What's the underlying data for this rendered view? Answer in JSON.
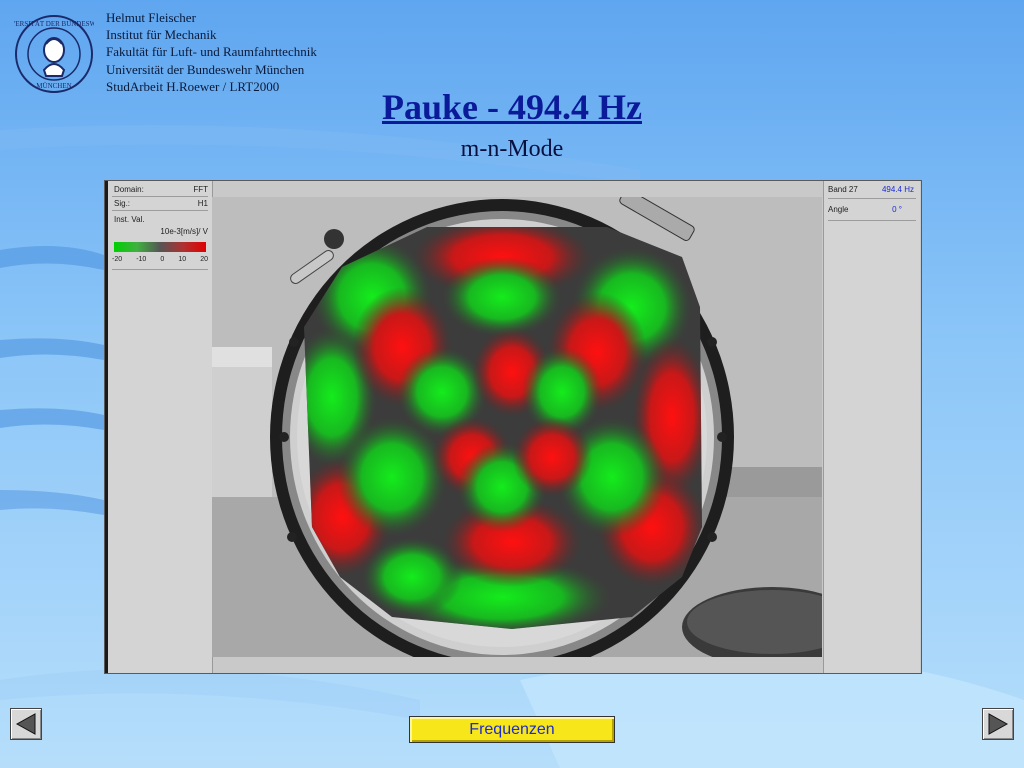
{
  "header": {
    "lines": [
      "Helmut Fleischer",
      "Institut für Mechanik",
      "Fakultät für Luft- und Raumfahrttechnik",
      "Universität der Bundeswehr München",
      "StudArbeit H.Roewer / LRT2000"
    ],
    "logo_text": "UNIVERSITÄT DER BUNDESWEHR MÜNCHEN"
  },
  "slide": {
    "title": "Pauke - 494.4 Hz",
    "subtitle": "m-n-Mode"
  },
  "viewer": {
    "left_panel": {
      "domain_label": "Domain:",
      "domain_value": "FFT",
      "sig_label": "Sig.:",
      "sig_value": "H1",
      "inst_label": "Inst. Val.",
      "unit": "10e-3[m/s]/ V",
      "scale_ticks": [
        "-20",
        "-10",
        "0",
        "10",
        "20"
      ]
    },
    "right_panel": {
      "band_label": "Band 27",
      "band_value": "494.4 Hz",
      "angle_label": "Angle",
      "angle_value": "0 °"
    }
  },
  "nav": {
    "frequenzen_label": "Frequenzen",
    "prev_icon": "triangle-left-icon",
    "next_icon": "triangle-right-icon"
  },
  "colors": {
    "title": "#0b1a99",
    "accent_yellow": "#f7e61a",
    "mode_green": "#10dc20",
    "mode_red": "#ff1010"
  }
}
